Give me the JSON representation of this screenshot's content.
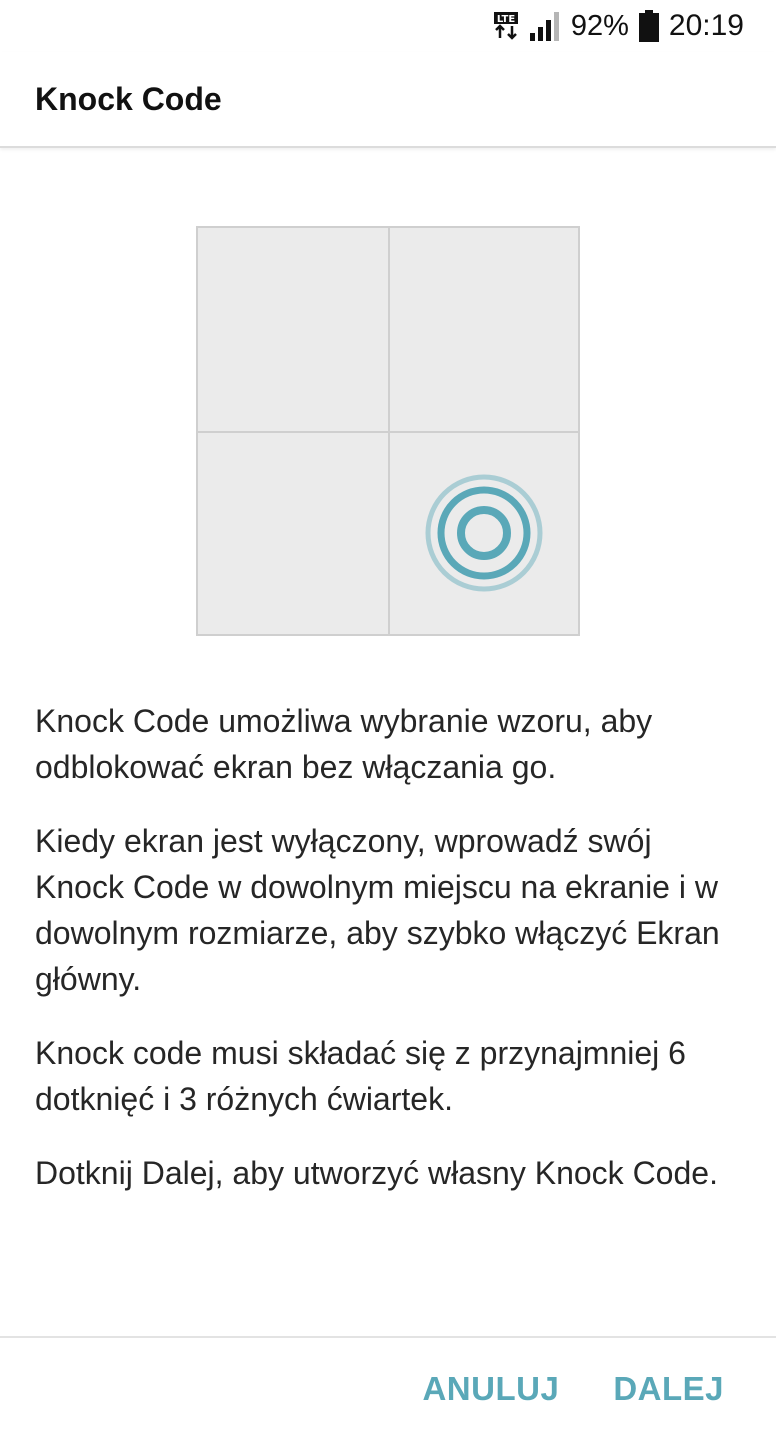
{
  "status_bar": {
    "network_type": "LTE",
    "battery_percent": "92%",
    "time": "20:19"
  },
  "app_bar": {
    "title": "Knock Code"
  },
  "illustration": {
    "icon": "knock-tap-icon",
    "accent_color": "#5aa8b8"
  },
  "content": {
    "paragraphs": [
      "Knock Code umożliwa wybranie wzoru, aby odblokować ekran bez włączania go.",
      "Kiedy ekran jest wyłączony, wprowadź swój Knock Code w dowolnym miejscu na ekranie i w dowolnym rozmiarze, aby szybko włączyć Ekran główny.",
      "Knock code musi składać się z przynajmniej 6 dotknięć i 3 różnych ćwiartek.",
      "Dotknij Dalej, aby utworzyć własny Knock Code."
    ]
  },
  "buttons": {
    "cancel_label": "ANULUJ",
    "next_label": "DALEJ",
    "color": "#5aa8b8"
  }
}
